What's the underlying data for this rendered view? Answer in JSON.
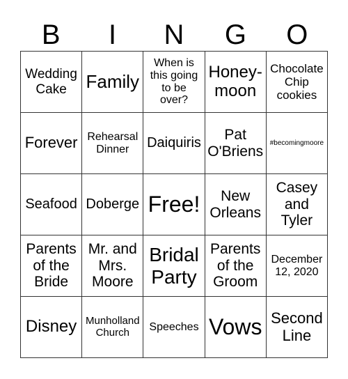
{
  "header": {
    "letters": [
      "B",
      "I",
      "N",
      "G",
      "O"
    ]
  },
  "board": {
    "rows": [
      [
        "Wedding Cake",
        "Family",
        "When is this going to be over?",
        "Honey-moon",
        "Chocolate Chip cookies"
      ],
      [
        "Forever",
        "Rehearsal Dinner",
        "Daiquiris",
        "Pat O'Briens",
        "#becomingmoore"
      ],
      [
        "Seafood",
        "Doberge",
        "Free!",
        "New Orleans",
        "Casey and Tyler"
      ],
      [
        "Parents of the Bride",
        "Mr. and Mrs. Moore",
        "Bridal Party",
        "Parents of the Groom",
        "December 12, 2020"
      ],
      [
        "Disney",
        "Munholland Church",
        "Speeches",
        "Vows",
        "Second Line"
      ]
    ]
  }
}
